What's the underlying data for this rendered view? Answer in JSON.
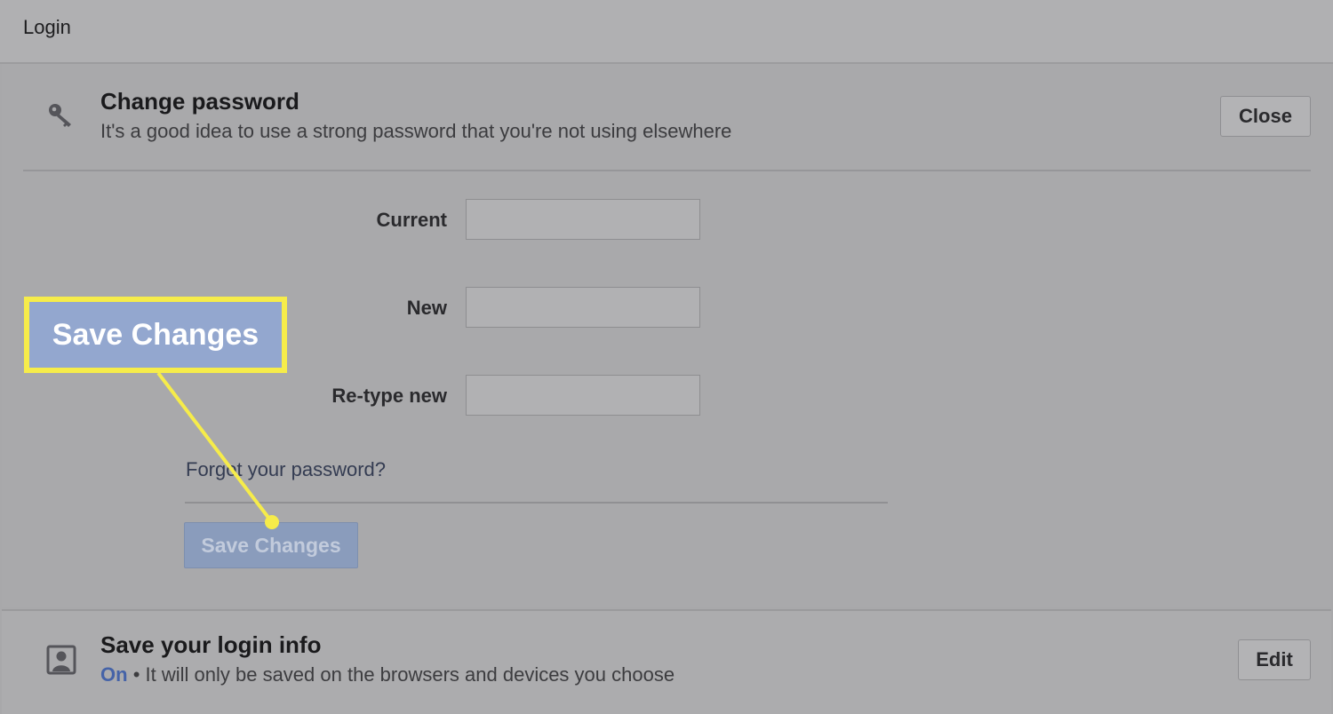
{
  "header": {
    "title": "Login"
  },
  "change_password": {
    "title": "Change password",
    "subtitle": "It's a good idea to use a strong password that you're not using elsewhere",
    "close_label": "Close",
    "fields": {
      "current_label": "Current",
      "new_label": "New",
      "retype_label": "Re-type new",
      "current_value": "",
      "new_value": "",
      "retype_value": ""
    },
    "forgot_link": "Forgot your password?",
    "save_label": "Save Changes"
  },
  "callout": {
    "text": "Save Changes",
    "border_color": "#f6ec4a"
  },
  "login_info": {
    "title": "Save your login info",
    "status": "On",
    "separator": "•",
    "description": "It will only be saved on the browsers and devices you choose",
    "edit_label": "Edit"
  },
  "icons": {
    "change_password": "key-icon",
    "login_info": "person-icon"
  },
  "colors": {
    "accent": "#4563a8",
    "save_button": "#8a9cbc",
    "highlight": "#f6ec4a"
  }
}
